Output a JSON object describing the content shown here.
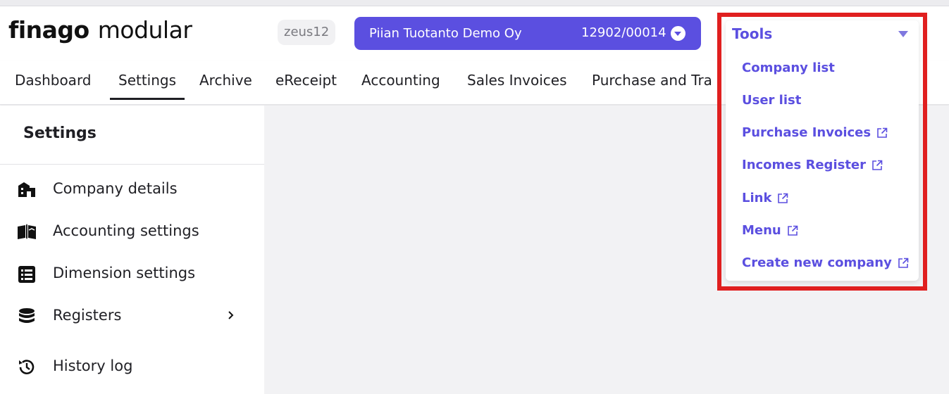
{
  "header": {
    "logo_brand": "finago",
    "logo_product": "modular",
    "user": "zeus12",
    "company_name": "Piian Tuotanto Demo Oy",
    "company_code": "12902/00014"
  },
  "nav": {
    "items": [
      {
        "label": "Dashboard"
      },
      {
        "label": "Settings"
      },
      {
        "label": "Archive"
      },
      {
        "label": "eReceipt"
      },
      {
        "label": "Accounting"
      },
      {
        "label": "Sales Invoices"
      },
      {
        "label": "Purchase and Tra"
      }
    ],
    "active": "Settings"
  },
  "sidebar": {
    "title": "Settings",
    "items": [
      {
        "label": "Company details",
        "icon": "building-icon"
      },
      {
        "label": "Accounting settings",
        "icon": "book-icon"
      },
      {
        "label": "Dimension settings",
        "icon": "list-icon"
      },
      {
        "label": "Registers",
        "icon": "database-icon"
      },
      {
        "label": "History log",
        "icon": "history-icon"
      }
    ]
  },
  "tools_menu": {
    "title": "Tools",
    "items": [
      {
        "label": "Company list",
        "external": false
      },
      {
        "label": "User list",
        "external": false
      },
      {
        "label": "Purchase Invoices",
        "external": true
      },
      {
        "label": "Incomes Register",
        "external": true
      },
      {
        "label": "Link",
        "external": true
      },
      {
        "label": "Menu",
        "external": true
      },
      {
        "label": "Create new company",
        "external": true
      }
    ]
  },
  "colors": {
    "accent": "#5b4fe0",
    "highlight": "#e01f1f"
  }
}
